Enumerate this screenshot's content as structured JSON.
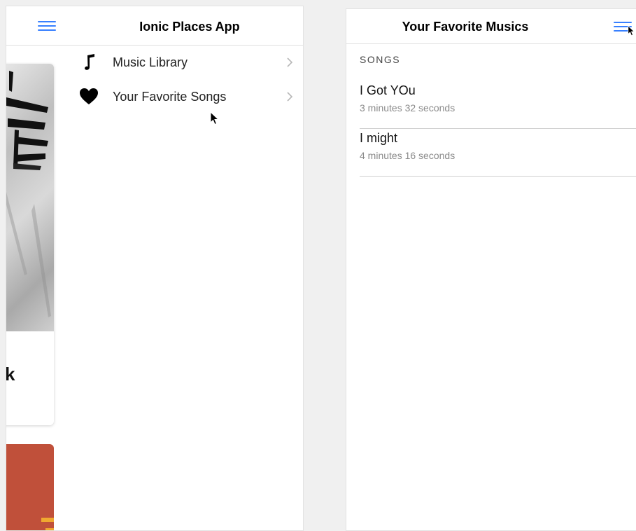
{
  "left_panel": {
    "title": "Ionic Places App",
    "menu_items": [
      {
        "label": "Music Library",
        "icon": "music-note-icon"
      },
      {
        "label": "Your Favorite Songs",
        "icon": "heart-icon"
      }
    ],
    "peek_text": "k"
  },
  "right_panel": {
    "title": "Your Favorite Musics",
    "section_header": "SONGS",
    "songs": [
      {
        "title": "I Got YOu",
        "duration": "3 minutes 32 seconds"
      },
      {
        "title": "I might",
        "duration": "4 minutes 16 seconds"
      }
    ]
  },
  "colors": {
    "accent": "#3880ff",
    "muted_text": "#8a8a8a",
    "divider": "#cfcfcf"
  }
}
